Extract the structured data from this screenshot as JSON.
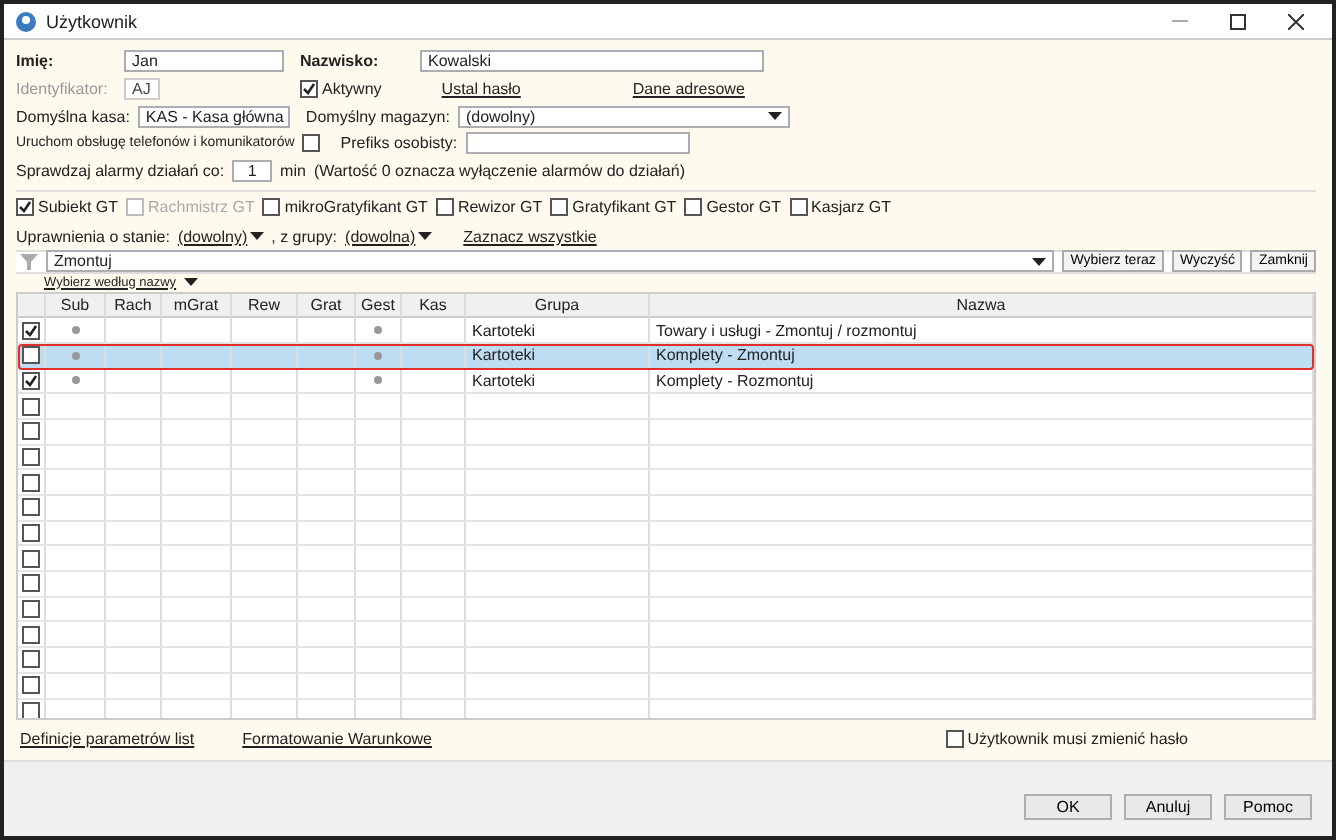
{
  "window": {
    "title": "Użytkownik"
  },
  "form": {
    "first_name": {
      "label": "Imię:",
      "value": "Jan"
    },
    "last_name": {
      "label": "Nazwisko:",
      "value": "Kowalski"
    },
    "identifier": {
      "label": "Identyfikator:",
      "value": "AJ",
      "disabled": true
    },
    "active": {
      "label": "Aktywny",
      "checked": true
    },
    "set_password": "Ustal hasło",
    "address_data": "Dane adresowe",
    "default_cash": {
      "label": "Domyślna kasa:",
      "value": "KAS - Kasa główna"
    },
    "default_warehouse": {
      "label": "Domyślny magazyn:",
      "value": "(dowolny)"
    },
    "phone_service": {
      "label": "Uruchom obsługę telefonów i komunikatorów",
      "checked": false
    },
    "personal_prefix": {
      "label": "Prefiks osobisty:"
    },
    "alarm_check": {
      "label": "Sprawdzaj alarmy działań co:",
      "value": "1",
      "unit": "min",
      "note": "(Wartość 0 oznacza wyłączenie alarmów do działań)"
    }
  },
  "products": [
    {
      "label": "Subiekt GT",
      "checked": true,
      "disabled": false
    },
    {
      "label": "Rachmistrz GT",
      "checked": false,
      "disabled": true
    },
    {
      "label": "mikroGratyfikant GT",
      "checked": false,
      "disabled": false
    },
    {
      "label": "Rewizor GT",
      "checked": false,
      "disabled": false
    },
    {
      "label": "Gratyfikant GT",
      "checked": false,
      "disabled": false
    },
    {
      "label": "Gestor GT",
      "checked": false,
      "disabled": false
    },
    {
      "label": "Kasjarz GT",
      "checked": false,
      "disabled": false
    }
  ],
  "permissions_filter": {
    "state_label": "Uprawnienia o stanie:",
    "state_value": "(dowolny)",
    "group_label": ", z grupy:",
    "group_value": "(dowolna)",
    "select_all": "Zaznacz wszystkie"
  },
  "search": {
    "value": "Zmontuj",
    "mode": "Wybierz według nazwy",
    "buttons": [
      "Wybierz teraz",
      "Wyczyść",
      "Zamknij"
    ]
  },
  "table": {
    "columns": [
      "Sub",
      "Rach",
      "mGrat",
      "Rew",
      "Grat",
      "Gest",
      "Kas",
      "Grupa",
      "Nazwa"
    ],
    "rows": [
      {
        "checked": true,
        "selected": false,
        "dots": [
          true,
          false,
          false,
          false,
          false,
          true,
          false
        ],
        "group": "Kartoteki",
        "name": "Towary i usługi - Zmontuj / rozmontuj"
      },
      {
        "checked": false,
        "selected": true,
        "dots": [
          true,
          false,
          false,
          false,
          false,
          true,
          false
        ],
        "group": "Kartoteki",
        "name": "Komplety - Zmontuj"
      },
      {
        "checked": true,
        "selected": false,
        "dots": [
          true,
          false,
          false,
          false,
          false,
          true,
          false
        ],
        "group": "Kartoteki",
        "name": "Komplety - Rozmontuj"
      },
      {
        "checked": false,
        "selected": false
      },
      {
        "checked": false,
        "selected": false
      },
      {
        "checked": false,
        "selected": false
      },
      {
        "checked": false,
        "selected": false
      },
      {
        "checked": false,
        "selected": false
      },
      {
        "checked": false,
        "selected": false
      },
      {
        "checked": false,
        "selected": false
      },
      {
        "checked": false,
        "selected": false
      },
      {
        "checked": false,
        "selected": false
      },
      {
        "checked": false,
        "selected": false
      },
      {
        "checked": false,
        "selected": false
      },
      {
        "checked": false,
        "selected": false
      },
      {
        "checked": false,
        "selected": false
      }
    ]
  },
  "footer_links": [
    "Definicje parametrów list",
    "Formatowanie Warunkowe"
  ],
  "must_change_password": {
    "label": "Użytkownik musi zmienić hasło",
    "checked": false
  },
  "buttons": [
    "OK",
    "Anuluj",
    "Pomoc"
  ]
}
